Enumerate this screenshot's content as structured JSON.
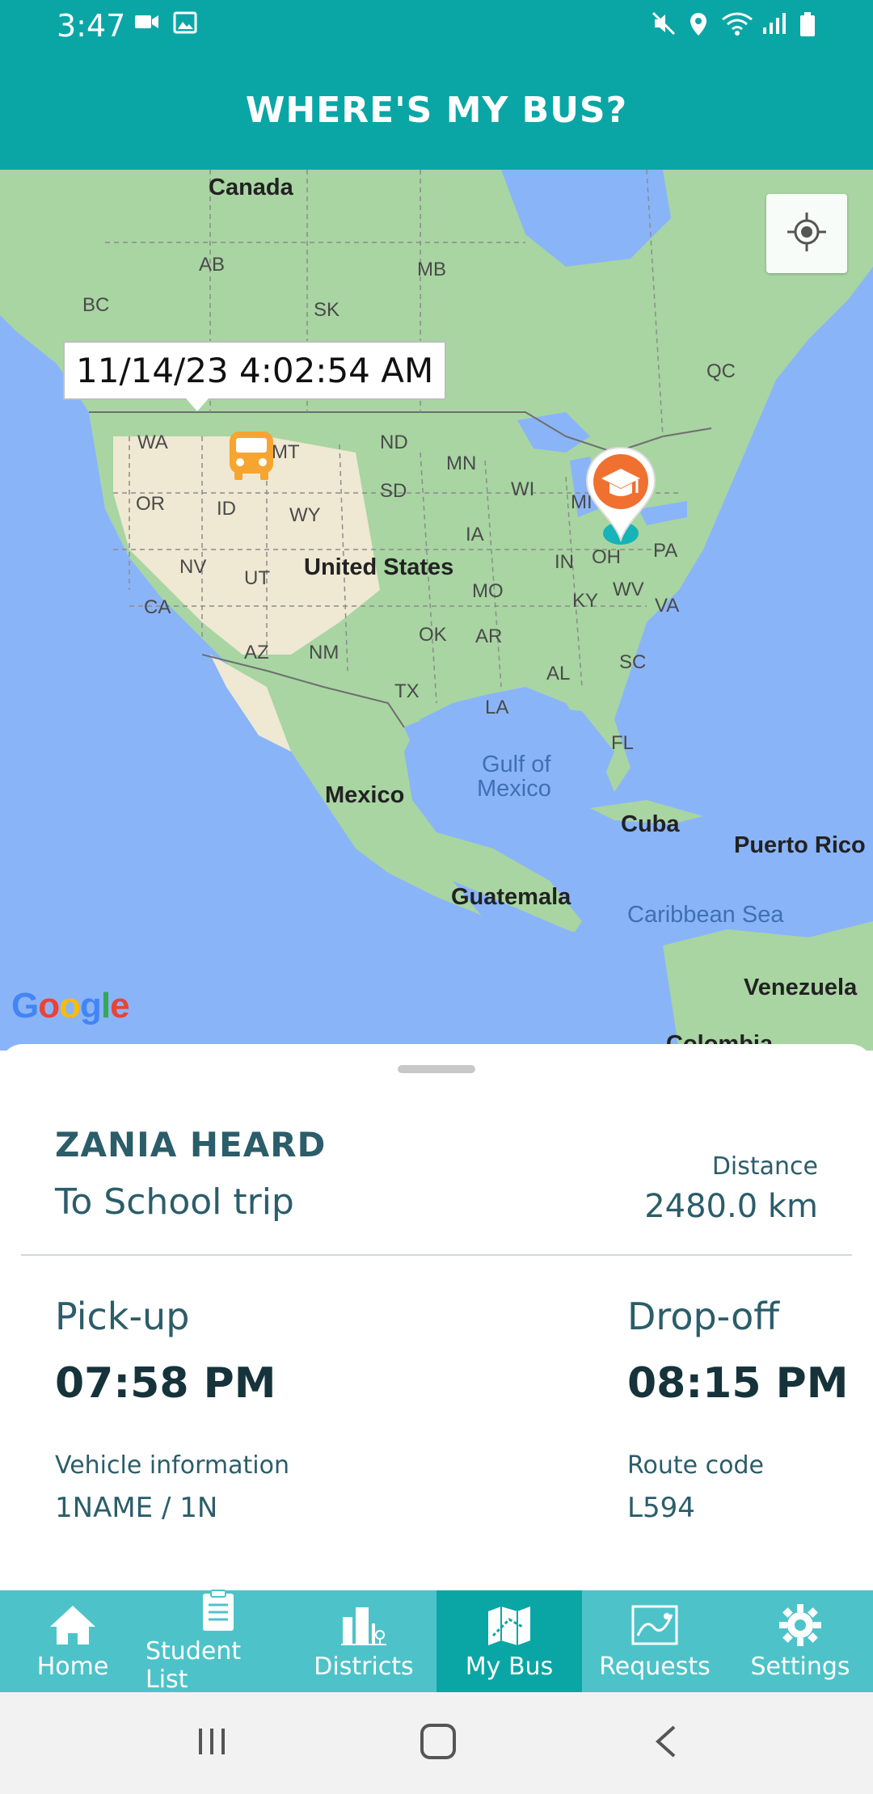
{
  "status_bar": {
    "time": "3:47",
    "icons": [
      "video-icon",
      "image-icon",
      "mute-icon",
      "location-icon",
      "wifi-icon",
      "signal-icon",
      "battery-icon"
    ]
  },
  "header": {
    "title": "WHERE'S MY BUS?"
  },
  "map": {
    "tooltip": "11/14/23 4:02:54 AM",
    "labels": {
      "canada": "Canada",
      "ab": "AB",
      "bc": "BC",
      "mb": "MB",
      "sk": "SK",
      "qc": "QC",
      "wa": "WA",
      "or": "OR",
      "id": "ID",
      "mt": "MT",
      "wy": "WY",
      "nd": "ND",
      "sd": "SD",
      "mn": "MN",
      "wi": "WI",
      "mi": "MI",
      "ia": "IA",
      "nv": "NV",
      "ut": "UT",
      "ca": "CA",
      "united_states": "United States",
      "in": "IN",
      "oh": "OH",
      "pa": "PA",
      "mo": "MO",
      "ky": "KY",
      "wv": "WV",
      "va": "VA",
      "az": "AZ",
      "nm": "NM",
      "ok": "OK",
      "ar": "AR",
      "sc": "SC",
      "tx": "TX",
      "al": "AL",
      "la": "LA",
      "fl": "FL",
      "gulf": "Gulf of",
      "mexico_water": "Mexico",
      "mexico": "Mexico",
      "cuba": "Cuba",
      "puerto_rico": "Puerto Rico",
      "guatemala": "Guatemala",
      "caribbean": "Caribbean Sea",
      "venezuela": "Venezuela",
      "colombia": "Colombia"
    },
    "attribution": "Google"
  },
  "trip": {
    "student_name": "ZANIA HEARD",
    "trip_name": "To School trip",
    "distance_label": "Distance",
    "distance_value": "2480.0 km",
    "pickup_label": "Pick-up",
    "pickup_time": "07:58 PM",
    "dropoff_label": "Drop-off",
    "dropoff_time": "08:15 PM",
    "vehicle_label": "Vehicle information",
    "vehicle_value": "1NAME / 1N",
    "route_label": "Route code",
    "route_value": "L594"
  },
  "tabs": [
    {
      "label": "Home",
      "icon": "home-icon"
    },
    {
      "label": "Student List",
      "icon": "clipboard-icon"
    },
    {
      "label": "Districts",
      "icon": "buildings-icon"
    },
    {
      "label": "My Bus",
      "icon": "bus-map-icon",
      "active": true
    },
    {
      "label": "Requests",
      "icon": "map-icon"
    },
    {
      "label": "Settings",
      "icon": "gear-icon"
    }
  ],
  "colors": {
    "brand": "#0aa6a6",
    "tab_bar": "#4dc3c9",
    "text_primary": "#2b5d6a",
    "bus_marker": "#f7a531",
    "school_marker": "#f07030"
  }
}
